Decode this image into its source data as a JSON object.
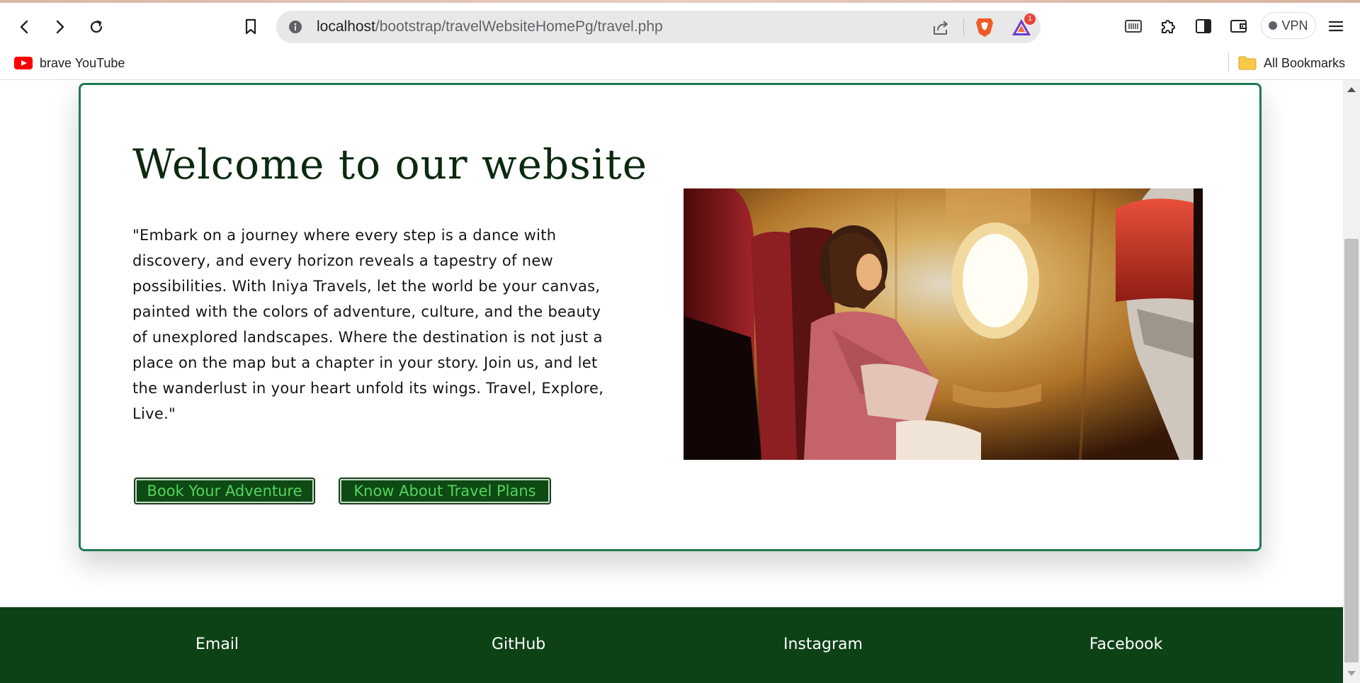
{
  "browser": {
    "url_host": "localhost",
    "url_path": "/bootstrap/travelWebsiteHomePg/travel.php",
    "rewards_badge": "1",
    "vpn_label": "VPN"
  },
  "bookmarks": {
    "items": [
      {
        "label": "brave YouTube",
        "icon": "youtube-icon"
      }
    ],
    "all_bookmarks_label": "All Bookmarks"
  },
  "hero": {
    "title": "Welcome to our website",
    "paragraph": "\"Embark on a journey where every step is a dance with discovery, and every horizon reveals a tapestry of new possibilities. With Iniya Travels, let the world be your canvas, painted with the colors of adventure, culture, and the beauty of unexplored landscapes. Where the destination is not just a place on the map but a chapter in your story. Join us, and let the wanderlust in your heart unfold its wings. Travel, Explore, Live.\"",
    "buttons": {
      "book": "Book Your Adventure",
      "plans": "Know About Travel Plans"
    },
    "image_alt": "woman looking out airplane window"
  },
  "footer": {
    "links": [
      "Email",
      "GitHub",
      "Instagram",
      "Facebook"
    ]
  },
  "colors": {
    "card_border": "#1f7a53",
    "heading": "#0b2910",
    "button_bg": "#0e4a14",
    "button_text": "#55d45f",
    "footer_bg": "#0d4216"
  }
}
